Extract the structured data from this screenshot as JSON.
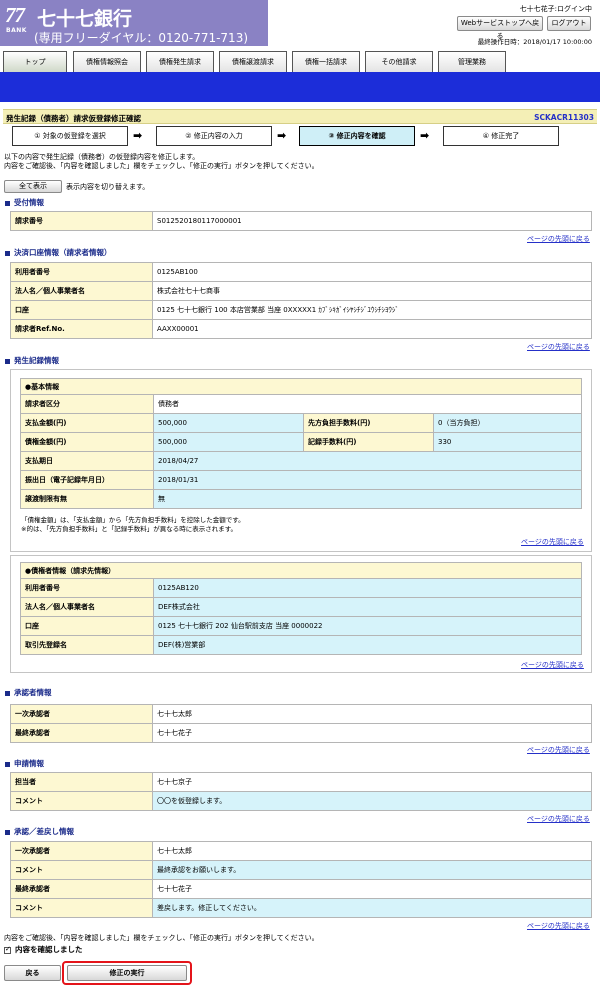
{
  "header": {
    "logo_number": "77",
    "logo_bank": "BANK",
    "bank_name": "七十七銀行",
    "free_dial": "(専用フリーダイヤル：0120-771-713)",
    "user_status": "七十七花子:ログイン中",
    "stop_label": "Webサービストップへ戻る",
    "logout_label": "ログアウト",
    "last_operation": "最終操作日時：2018/01/17 10:00:00"
  },
  "nav": {
    "tabs": [
      "トップ",
      "債権情報照会",
      "債権発生請求",
      "債権譲渡請求",
      "債権一括請求",
      "その他請求",
      "管理業務"
    ]
  },
  "title": {
    "text": "発生記録（債務者）請求仮登録修正確認",
    "code": "SCKACR11303"
  },
  "steps": [
    "① 対象の仮登録を選択",
    "② 修正内容の入力",
    "③ 修正内容を確認",
    "④ 修正完了"
  ],
  "instructions": {
    "line1": "以下の内容で発生記録（債務者）の仮登録内容を修正します。",
    "line2": "内容をご確認後、「内容を確認しました」欄をチェックし、「修正の実行」ボタンを押してください。",
    "show_all_label": "全て表示",
    "show_all_desc": "表示内容を切り替えます。"
  },
  "page_top_link": "ページの先頭に戻る",
  "reception": {
    "title": "受付情報",
    "rows": [
      {
        "label": "請求番号",
        "value": "S012520180117000001"
      }
    ]
  },
  "settlement": {
    "title": "決済口座情報（請求者情報）",
    "rows": [
      {
        "label": "利用者番号",
        "value": "0125AB100"
      },
      {
        "label": "法人名／個人事業者名",
        "value": "株式会社七十七商事"
      },
      {
        "label": "口座",
        "value": "0125 七十七銀行 100 本店営業部 当座 0XXXXX1 ｶﾌﾞｼｷｶﾞｲｼﾔｼﾁｼﾞﾕｳｼﾁｼﾖｳｼﾞ"
      },
      {
        "label": "請求者Ref.No.",
        "value": "AAXX00001"
      }
    ]
  },
  "issuance": {
    "title": "発生記録情報",
    "basic_header": "●基本情報",
    "basic": {
      "kubun_label": "請求者区分",
      "kubun_value": "債務者",
      "pay_label": "支払金額(円)",
      "pay_value": "500,000",
      "fee_label": "先方負担手数料(円)",
      "fee_value": "0（当方負担）",
      "credit_label": "債権金額(円)",
      "credit_value": "500,000",
      "rec_fee_label": "記録手数料(円)",
      "rec_fee_value": "330",
      "due_label": "支払期日",
      "due_value": "2018/04/27",
      "date_label": "振出日（電子記録年月日）",
      "date_value": "2018/01/31",
      "transfer_label": "譲渡制限有無",
      "transfer_value": "無"
    },
    "note1": "「債権金額」は、「支払金額」から「先方負担手数料」を控除した金額です。",
    "note2": "※的は、「先方負担手数料」と「記録手数料」が異なる時に表示されます。",
    "creditor_header": "●債権者情報（請求先情報）",
    "creditor": [
      {
        "label": "利用者番号",
        "value": "0125AB120"
      },
      {
        "label": "法人名／個人事業者名",
        "value": "DEF株式会社"
      },
      {
        "label": "口座",
        "value": "0125 七十七銀行 202 仙台駅前支店 当座 0000022"
      },
      {
        "label": "取引先登録名",
        "value": "DEF(株)営業部"
      }
    ]
  },
  "approver": {
    "title": "承認者情報",
    "rows": [
      {
        "label": "一次承認者",
        "value": "七十七太郎"
      },
      {
        "label": "最終承認者",
        "value": "七十七花子"
      }
    ]
  },
  "application": {
    "title": "申請情報",
    "rows": [
      {
        "label": "担当者",
        "value": "七十七京子"
      },
      {
        "label": "コメント",
        "value": "〇〇を仮登録します。"
      }
    ]
  },
  "approval_return": {
    "title": "承認／差戻し情報",
    "rows": [
      {
        "label": "一次承認者",
        "value": "七十七太郎"
      },
      {
        "label": "コメント",
        "value": "最終承認をお願いします。"
      },
      {
        "label": "最終承認者",
        "value": "七十七花子"
      },
      {
        "label": "コメント",
        "value": "差戻します。修正してください。"
      }
    ]
  },
  "footer": {
    "instruction": "内容をご確認後、「内容を確認しました」欄をチェックし、「修正の実行」ボタンを押してください。",
    "confirm_label": "内容を確認しました",
    "back_label": "戻る",
    "exec_label": "修正の実行"
  }
}
